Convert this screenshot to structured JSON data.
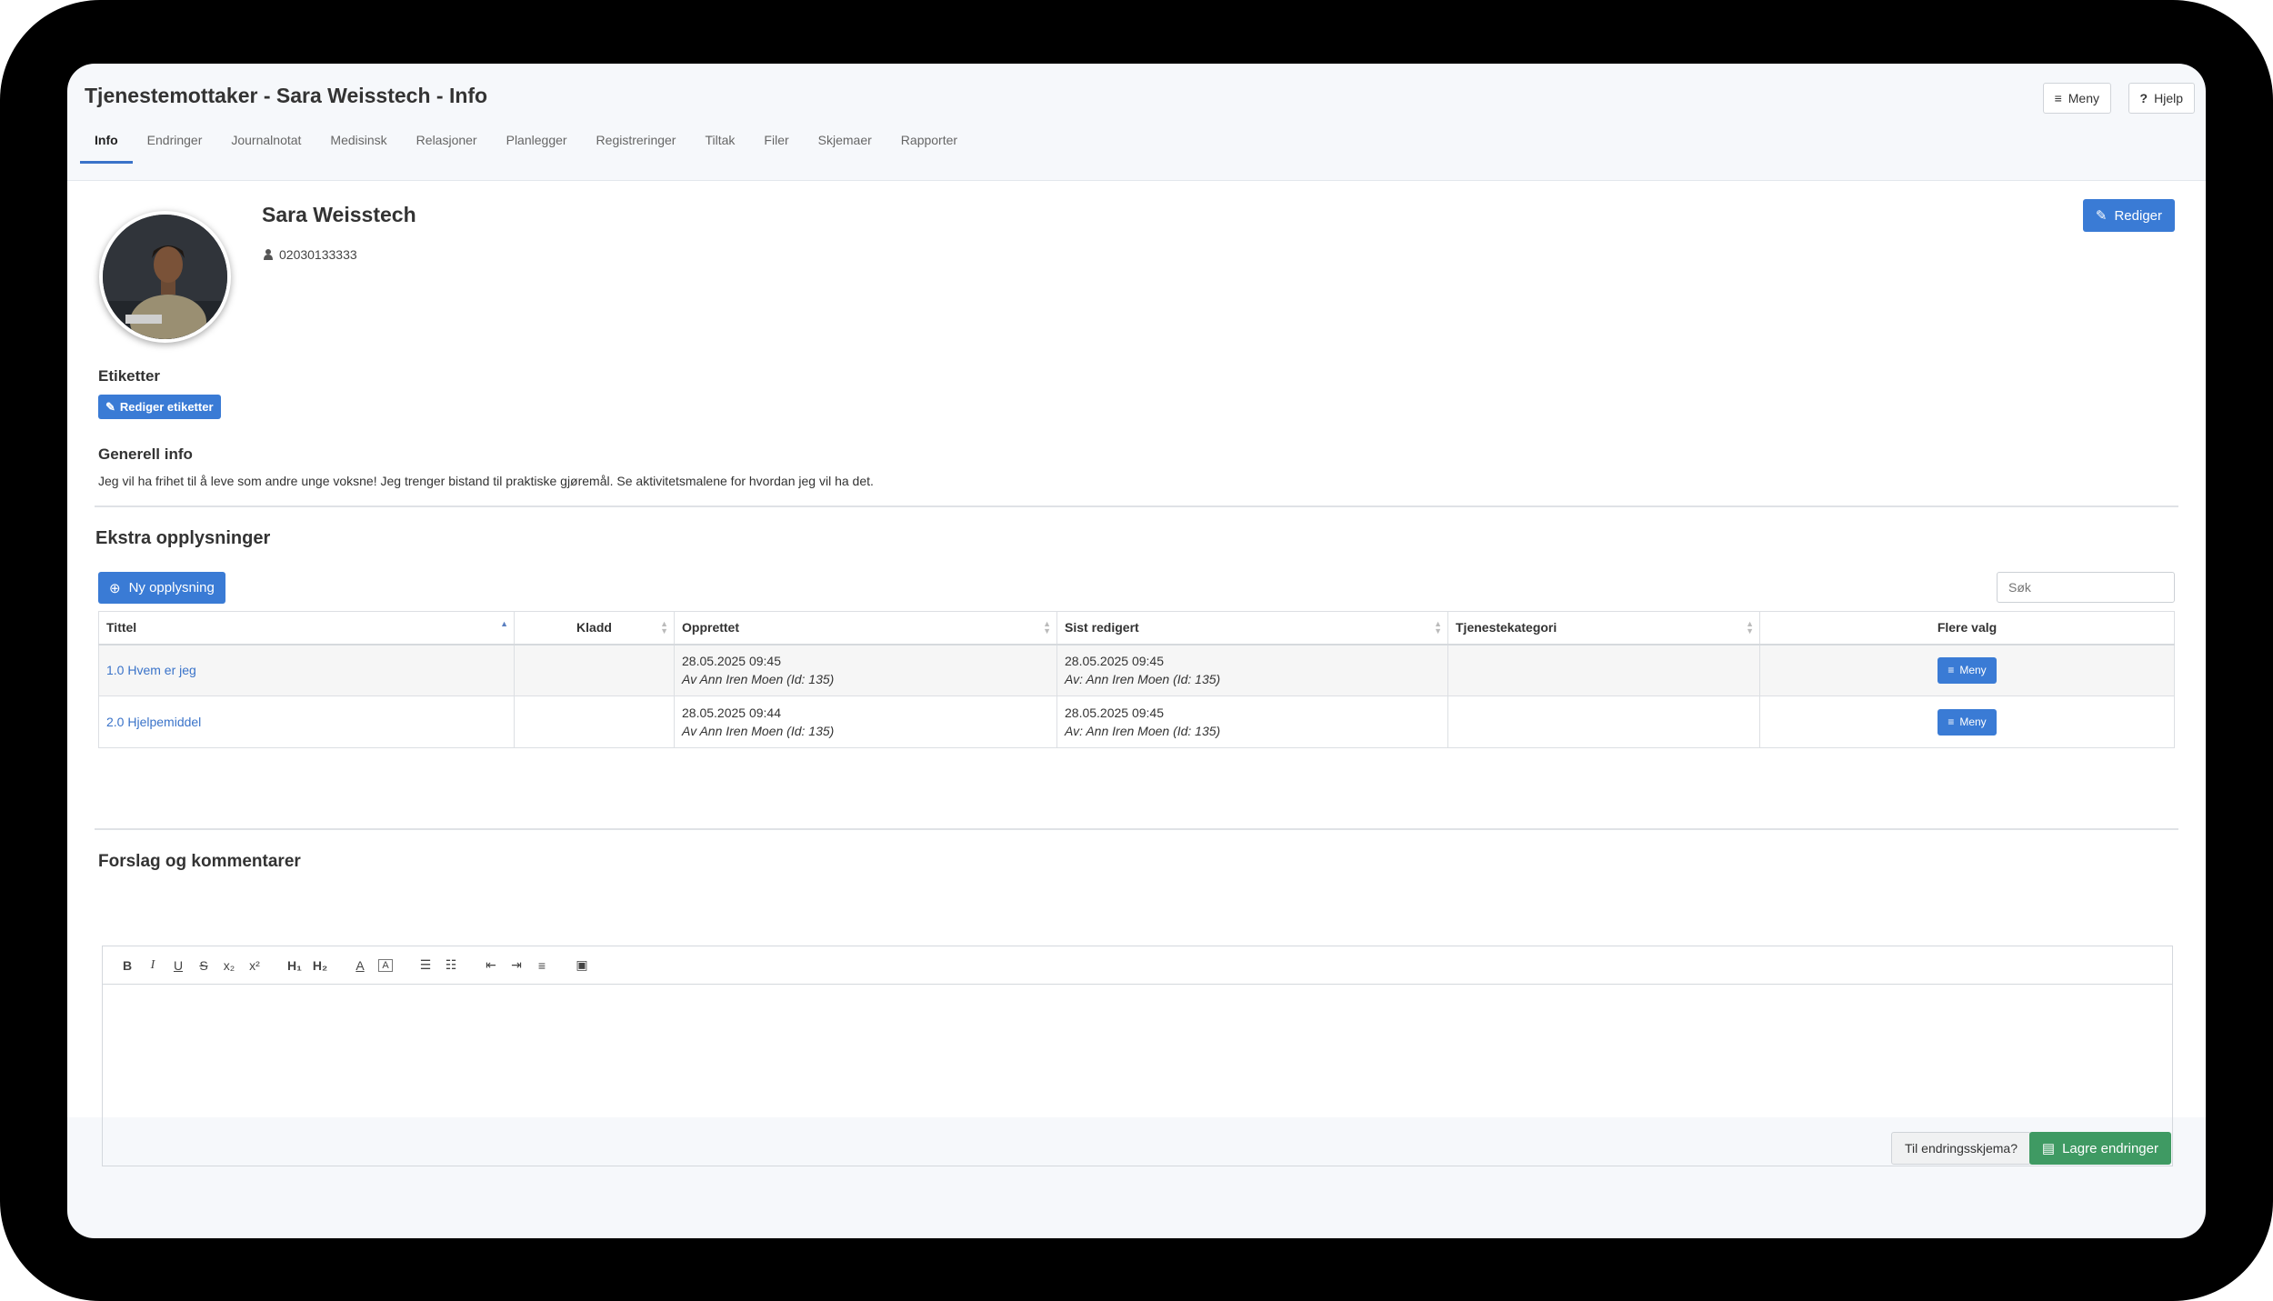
{
  "header": {
    "title": "Tjenestemottaker - Sara Weisstech - Info",
    "menu_label": "Meny",
    "help_label": "Hjelp"
  },
  "tabs": [
    {
      "label": "Info",
      "active": true
    },
    {
      "label": "Endringer"
    },
    {
      "label": "Journalnotat"
    },
    {
      "label": "Medisinsk"
    },
    {
      "label": "Relasjoner"
    },
    {
      "label": "Planlegger"
    },
    {
      "label": "Registreringer"
    },
    {
      "label": "Tiltak"
    },
    {
      "label": "Filer"
    },
    {
      "label": "Skjemaer"
    },
    {
      "label": "Rapporter"
    }
  ],
  "profile": {
    "name": "Sara Weisstech",
    "id_number": "02030133333",
    "edit_label": "Rediger"
  },
  "labels": {
    "heading": "Etiketter",
    "edit_label": "Rediger etiketter"
  },
  "general": {
    "heading": "Generell info",
    "text": "Jeg vil ha frihet til å leve som andre unge voksne! Jeg trenger bistand til praktiske gjøremål. Se aktivitetsmalene for hvordan jeg vil ha det."
  },
  "extra": {
    "heading": "Ekstra opplysninger",
    "new_label": "Ny opplysning",
    "search_placeholder": "Søk",
    "columns": [
      "Tittel",
      "Kladd",
      "Opprettet",
      "Sist redigert",
      "Tjenestekategori",
      "Flere valg"
    ],
    "rows": [
      {
        "title": "1.0 Hvem er jeg",
        "draft": "",
        "created": "28.05.2025 09:45",
        "created_by": "Av Ann Iren Moen (Id: 135)",
        "edited": "28.05.2025 09:45",
        "edited_by": "Av: Ann Iren Moen (Id: 135)",
        "category": "",
        "menu_label": "Meny"
      },
      {
        "title": "2.0 Hjelpemiddel",
        "draft": "",
        "created": "28.05.2025 09:44",
        "created_by": "Av Ann Iren Moen (Id: 135)",
        "edited": "28.05.2025 09:45",
        "edited_by": "Av: Ann Iren Moen (Id: 135)",
        "category": "",
        "menu_label": "Meny"
      }
    ]
  },
  "comments": {
    "heading": "Forslag og kommentarer",
    "toolbar": {
      "bold": "B",
      "italic": "I",
      "underline": "U",
      "strike": "S",
      "subscript": "x₂",
      "superscript": "x²",
      "h1": "H₁",
      "h2": "H₂"
    },
    "to_change_form_label": "Til endringsskjema?",
    "save_label": "Lagre endringer"
  }
}
